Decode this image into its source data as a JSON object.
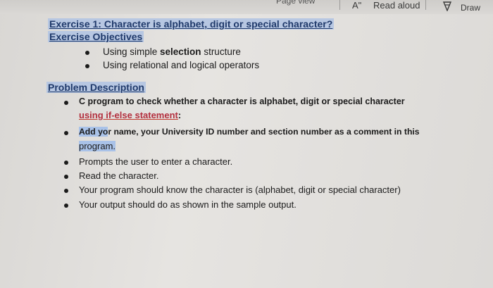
{
  "toolbar": {
    "page_view": "Page view",
    "font_glyph": "A\"",
    "read_aloud": "Read aloud",
    "draw": "Draw"
  },
  "exercise": {
    "title": "Exercise 1: Character is alphabet, digit or special character?",
    "objectives_heading": "Exercise Objectives",
    "objectives": [
      {
        "pre": "Using simple ",
        "bold": "selection",
        "post": " structure"
      },
      {
        "text": "Using relational and logical operators"
      }
    ],
    "problem_heading": "Problem Description",
    "desc": {
      "item1_line1": "C program to check whether a character is alphabet, digit or special character",
      "item1_line2": "using if-else statement",
      "item1_colon": ":",
      "item2_selected": "Add yo",
      "item2_rest1": "r name, your University ID number and section number as a comment in this",
      "item2_line2": "program.",
      "item3": "Prompts the user to enter a character.",
      "item4": "Read the character.",
      "item5": "Your program should know the character is (alphabet, digit or special character)",
      "item6": "Your output should do as shown in the sample output."
    }
  },
  "colors": {
    "highlight": "#b7c7e2",
    "heading_text": "#203a6b",
    "red_underline": "#c0392b"
  }
}
